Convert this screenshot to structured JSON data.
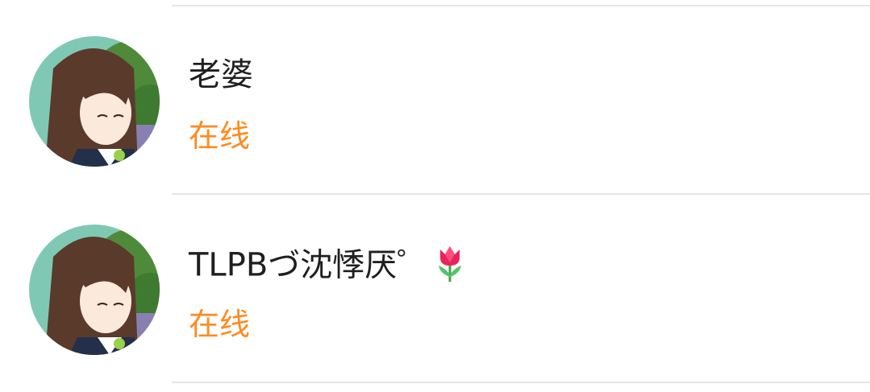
{
  "contacts": [
    {
      "name": "老婆",
      "status": "在线",
      "avatar": "anime-girl-avatar",
      "emoji": ""
    },
    {
      "name": "TLPBづ沈悸厌゜",
      "status": "在线",
      "avatar": "anime-girl-avatar",
      "emoji": "tulip-icon"
    }
  ],
  "colors": {
    "status_online": "#ff8a1f",
    "name_text": "#1f1f1f",
    "divider": "#e6e6e6"
  }
}
